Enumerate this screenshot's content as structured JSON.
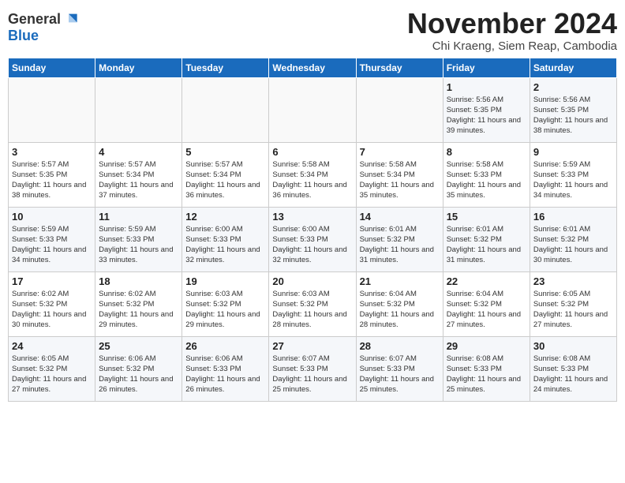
{
  "header": {
    "logo_general": "General",
    "logo_blue": "Blue",
    "month": "November 2024",
    "location": "Chi Kraeng, Siem Reap, Cambodia"
  },
  "days_of_week": [
    "Sunday",
    "Monday",
    "Tuesday",
    "Wednesday",
    "Thursday",
    "Friday",
    "Saturday"
  ],
  "weeks": [
    [
      {
        "day": "",
        "info": ""
      },
      {
        "day": "",
        "info": ""
      },
      {
        "day": "",
        "info": ""
      },
      {
        "day": "",
        "info": ""
      },
      {
        "day": "",
        "info": ""
      },
      {
        "day": "1",
        "info": "Sunrise: 5:56 AM\nSunset: 5:35 PM\nDaylight: 11 hours and 39 minutes."
      },
      {
        "day": "2",
        "info": "Sunrise: 5:56 AM\nSunset: 5:35 PM\nDaylight: 11 hours and 38 minutes."
      }
    ],
    [
      {
        "day": "3",
        "info": "Sunrise: 5:57 AM\nSunset: 5:35 PM\nDaylight: 11 hours and 38 minutes."
      },
      {
        "day": "4",
        "info": "Sunrise: 5:57 AM\nSunset: 5:34 PM\nDaylight: 11 hours and 37 minutes."
      },
      {
        "day": "5",
        "info": "Sunrise: 5:57 AM\nSunset: 5:34 PM\nDaylight: 11 hours and 36 minutes."
      },
      {
        "day": "6",
        "info": "Sunrise: 5:58 AM\nSunset: 5:34 PM\nDaylight: 11 hours and 36 minutes."
      },
      {
        "day": "7",
        "info": "Sunrise: 5:58 AM\nSunset: 5:34 PM\nDaylight: 11 hours and 35 minutes."
      },
      {
        "day": "8",
        "info": "Sunrise: 5:58 AM\nSunset: 5:33 PM\nDaylight: 11 hours and 35 minutes."
      },
      {
        "day": "9",
        "info": "Sunrise: 5:59 AM\nSunset: 5:33 PM\nDaylight: 11 hours and 34 minutes."
      }
    ],
    [
      {
        "day": "10",
        "info": "Sunrise: 5:59 AM\nSunset: 5:33 PM\nDaylight: 11 hours and 34 minutes."
      },
      {
        "day": "11",
        "info": "Sunrise: 5:59 AM\nSunset: 5:33 PM\nDaylight: 11 hours and 33 minutes."
      },
      {
        "day": "12",
        "info": "Sunrise: 6:00 AM\nSunset: 5:33 PM\nDaylight: 11 hours and 32 minutes."
      },
      {
        "day": "13",
        "info": "Sunrise: 6:00 AM\nSunset: 5:33 PM\nDaylight: 11 hours and 32 minutes."
      },
      {
        "day": "14",
        "info": "Sunrise: 6:01 AM\nSunset: 5:32 PM\nDaylight: 11 hours and 31 minutes."
      },
      {
        "day": "15",
        "info": "Sunrise: 6:01 AM\nSunset: 5:32 PM\nDaylight: 11 hours and 31 minutes."
      },
      {
        "day": "16",
        "info": "Sunrise: 6:01 AM\nSunset: 5:32 PM\nDaylight: 11 hours and 30 minutes."
      }
    ],
    [
      {
        "day": "17",
        "info": "Sunrise: 6:02 AM\nSunset: 5:32 PM\nDaylight: 11 hours and 30 minutes."
      },
      {
        "day": "18",
        "info": "Sunrise: 6:02 AM\nSunset: 5:32 PM\nDaylight: 11 hours and 29 minutes."
      },
      {
        "day": "19",
        "info": "Sunrise: 6:03 AM\nSunset: 5:32 PM\nDaylight: 11 hours and 29 minutes."
      },
      {
        "day": "20",
        "info": "Sunrise: 6:03 AM\nSunset: 5:32 PM\nDaylight: 11 hours and 28 minutes."
      },
      {
        "day": "21",
        "info": "Sunrise: 6:04 AM\nSunset: 5:32 PM\nDaylight: 11 hours and 28 minutes."
      },
      {
        "day": "22",
        "info": "Sunrise: 6:04 AM\nSunset: 5:32 PM\nDaylight: 11 hours and 27 minutes."
      },
      {
        "day": "23",
        "info": "Sunrise: 6:05 AM\nSunset: 5:32 PM\nDaylight: 11 hours and 27 minutes."
      }
    ],
    [
      {
        "day": "24",
        "info": "Sunrise: 6:05 AM\nSunset: 5:32 PM\nDaylight: 11 hours and 27 minutes."
      },
      {
        "day": "25",
        "info": "Sunrise: 6:06 AM\nSunset: 5:32 PM\nDaylight: 11 hours and 26 minutes."
      },
      {
        "day": "26",
        "info": "Sunrise: 6:06 AM\nSunset: 5:33 PM\nDaylight: 11 hours and 26 minutes."
      },
      {
        "day": "27",
        "info": "Sunrise: 6:07 AM\nSunset: 5:33 PM\nDaylight: 11 hours and 25 minutes."
      },
      {
        "day": "28",
        "info": "Sunrise: 6:07 AM\nSunset: 5:33 PM\nDaylight: 11 hours and 25 minutes."
      },
      {
        "day": "29",
        "info": "Sunrise: 6:08 AM\nSunset: 5:33 PM\nDaylight: 11 hours and 25 minutes."
      },
      {
        "day": "30",
        "info": "Sunrise: 6:08 AM\nSunset: 5:33 PM\nDaylight: 11 hours and 24 minutes."
      }
    ]
  ]
}
